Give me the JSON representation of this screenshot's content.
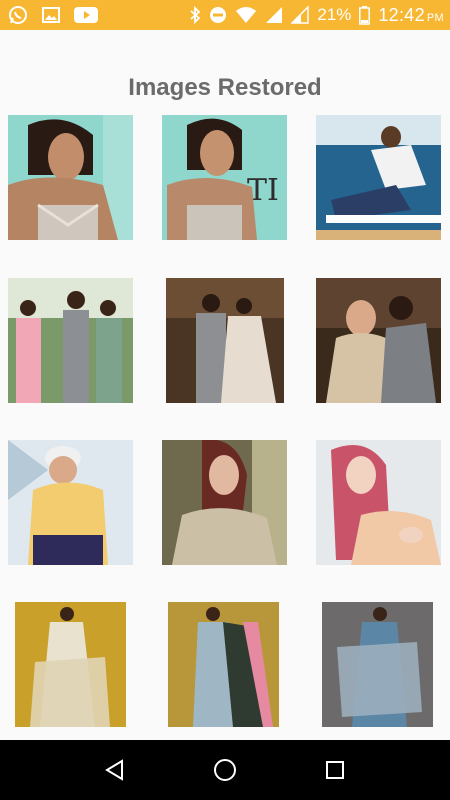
{
  "status_bar": {
    "battery_percent": "21%",
    "time": "12:42",
    "ampm": "PM",
    "left_icons": [
      "whatsapp-icon",
      "gallery-icon",
      "youtube-icon"
    ],
    "right_icons": [
      "bluetooth-icon",
      "do-not-disturb-icon",
      "wifi-icon",
      "signal-icon",
      "signal-2-icon",
      "battery-icon"
    ],
    "background_color": "#f7b733"
  },
  "header": {
    "title": "Images Restored"
  },
  "gallery": {
    "rows": 4,
    "columns": 3,
    "items": [
      {
        "name": "restored-image-1",
        "row": 1,
        "col": 1
      },
      {
        "name": "restored-image-2",
        "row": 1,
        "col": 2
      },
      {
        "name": "restored-image-3",
        "row": 1,
        "col": 3
      },
      {
        "name": "restored-image-4",
        "row": 2,
        "col": 1
      },
      {
        "name": "restored-image-5",
        "row": 2,
        "col": 2
      },
      {
        "name": "restored-image-6",
        "row": 2,
        "col": 3
      },
      {
        "name": "restored-image-7",
        "row": 3,
        "col": 1
      },
      {
        "name": "restored-image-8",
        "row": 3,
        "col": 2
      },
      {
        "name": "restored-image-9",
        "row": 3,
        "col": 3
      },
      {
        "name": "restored-image-10",
        "row": 4,
        "col": 1
      },
      {
        "name": "restored-image-11",
        "row": 4,
        "col": 2
      },
      {
        "name": "restored-image-12",
        "row": 4,
        "col": 3
      }
    ]
  },
  "nav_bar": {
    "buttons": [
      "back-icon",
      "home-icon",
      "recents-icon"
    ]
  }
}
